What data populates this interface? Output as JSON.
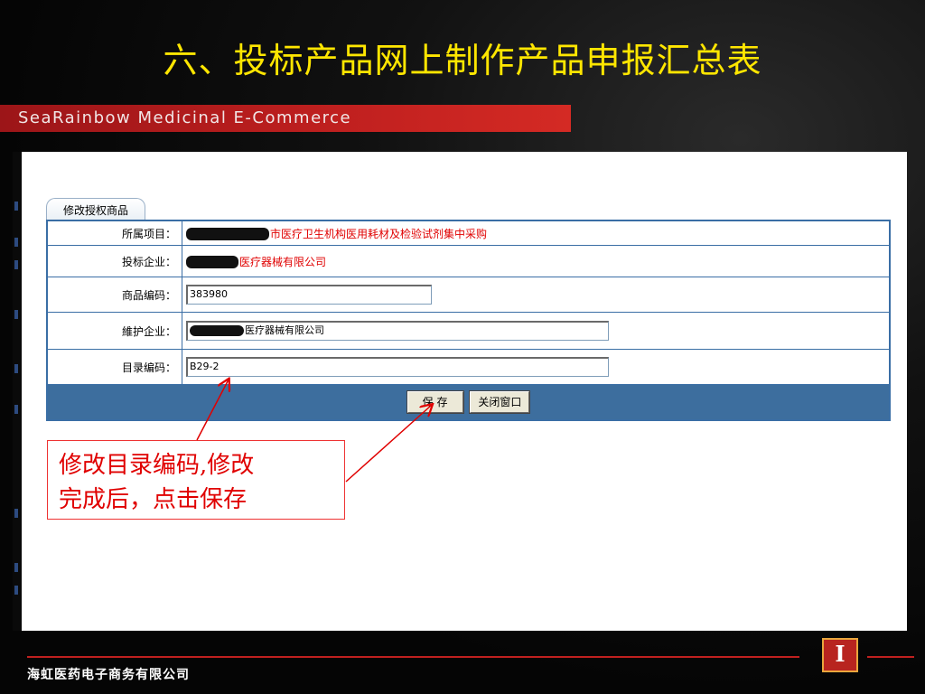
{
  "slide": {
    "title": "六、投标产品网上制作产品申报汇总表",
    "brand_banner": "SeaRainbow  Medicinal  E-Commerce",
    "footer_company": "海虹医药电子商务有限公司",
    "logo_glyph": "I"
  },
  "form": {
    "tab_label": "修改授权商品",
    "rows": {
      "project": {
        "label": "所属项目：",
        "value": "市医疗卫生机构医用耗材及检验试剂集中采购"
      },
      "bidder": {
        "label": "投标企业：",
        "value": "医疗器械有限公司"
      },
      "product_code": {
        "label": "商品编码：",
        "value": "383980"
      },
      "maintainer": {
        "label": "維护企业：",
        "value": "医疗器械有限公司"
      },
      "catalog_code": {
        "label": "目录编码：",
        "value": "B29-2"
      }
    },
    "buttons": {
      "save": "保  存",
      "close": "关闭窗口"
    }
  },
  "annotation": {
    "line1": "修改目录编码,修改",
    "line2": "完成后，点击保存"
  },
  "colors": {
    "title": "#ffe600",
    "brand_bar": "#c0201f",
    "form_border": "#3a6ea5",
    "action_row": "#3d6e9e",
    "annotation": "#e00000"
  }
}
